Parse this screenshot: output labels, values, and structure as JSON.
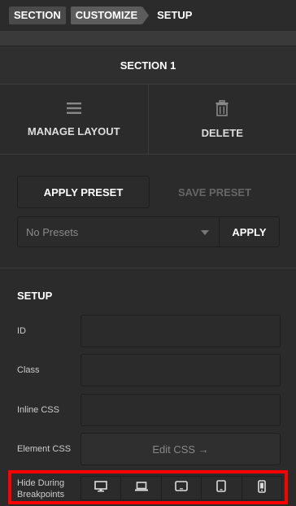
{
  "breadcrumbs": {
    "items": [
      "SECTION",
      "CUSTOMIZE",
      "SETUP"
    ]
  },
  "section_title": "SECTION 1",
  "actions": {
    "manage_layout": {
      "label": "MANAGE LAYOUT",
      "icon": "menu-icon"
    },
    "delete": {
      "label": "DELETE",
      "icon": "trash-icon"
    }
  },
  "presets": {
    "apply_preset_label": "APPLY PRESET",
    "save_preset_label": "SAVE PRESET",
    "select_value": "No Presets",
    "apply_label": "APPLY"
  },
  "setup": {
    "heading": "SETUP",
    "fields": {
      "id_label": "ID",
      "id_value": "",
      "class_label": "Class",
      "class_value": "",
      "inline_css_label": "Inline CSS",
      "inline_css_value": "",
      "element_css_label": "Element CSS",
      "edit_css_label": "Edit CSS →"
    },
    "hide_breakpoints": {
      "label_line1": "Hide During",
      "label_line2": "Breakpoints",
      "icons": [
        "desktop-icon",
        "laptop-icon",
        "tablet-landscape-icon",
        "tablet-portrait-icon",
        "phone-icon"
      ]
    }
  },
  "colors": {
    "background": "#2b2b2b",
    "highlight": "#ff0000",
    "muted_text": "#666666"
  }
}
